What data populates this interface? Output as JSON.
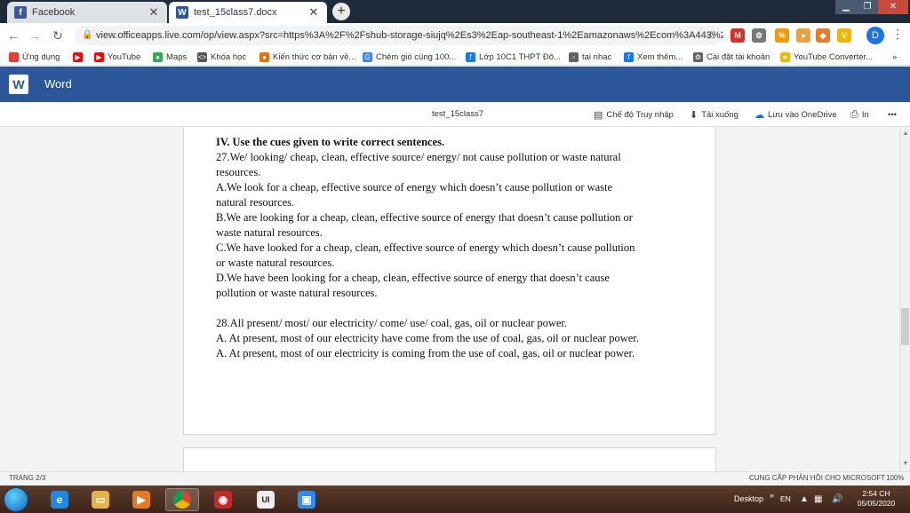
{
  "browser": {
    "tabs": [
      {
        "label": "Facebook",
        "icon": "facebook-icon",
        "color": "#3b5998"
      },
      {
        "label": "test_15class7.docx",
        "icon": "word-icon",
        "color": "#2b579a"
      }
    ],
    "url": "view.officeapps.live.com/op/view.aspx?src=https%3A%2F%2Fshub-storage-siujq%2Es3%2Eap-southeast-1%2Eamazonaws%2Ecom%3A443%2Ft...",
    "profile_initial": "D",
    "bookmarks": [
      {
        "label": "Ứng dụng",
        "icon": "apps-icon",
        "color": "#e53935"
      },
      {
        "label": "",
        "icon": "youtube-icon",
        "color": "#ff0000"
      },
      {
        "label": "YouTube",
        "icon": "youtube-icon",
        "color": "#ff0000"
      },
      {
        "label": "Maps",
        "icon": "maps-icon",
        "color": "#34a853"
      },
      {
        "label": "Khóa học",
        "icon": "code-icon",
        "color": "#555555"
      },
      {
        "label": "Kiến thức cơ bản về...",
        "icon": "github-icon",
        "color": "#e8710a"
      },
      {
        "label": "Chém gió cùng 100...",
        "icon": "google-icon",
        "color": "#4285f4"
      },
      {
        "label": "Lớp 10C1 THPT Đô...",
        "icon": "facebook-icon",
        "color": "#1877f2"
      },
      {
        "label": "tai nhac",
        "icon": "page-icon",
        "color": "#5f6368"
      },
      {
        "label": "Xem thêm...",
        "icon": "facebook-icon",
        "color": "#1877f2"
      },
      {
        "label": "Cài đặt tài khoản",
        "icon": "settings-icon",
        "color": "#5f6368"
      },
      {
        "label": "YouTube Converter...",
        "icon": "bookmark-icon",
        "color": "#f4b400"
      }
    ]
  },
  "word": {
    "app_name": "Word",
    "doc_name": "test_15class7",
    "toolbar": {
      "reading_mode": "Chế độ Truy nhập",
      "download": "Tải xuống",
      "save_onedrive": "Lưu vào OneDrive",
      "print": "In",
      "more": "•••"
    }
  },
  "document": {
    "lines": [
      {
        "text": "IV. Use the cues given to write correct sentences.",
        "bold": true
      },
      {
        "text": "27.We/ looking/ cheap, clean, effective source/ energy/ not cause pollution or waste natural"
      },
      {
        "text": "resources."
      },
      {
        "text": "A.We look for a cheap, effective source of energy which doesn’t cause pollution or waste"
      },
      {
        "text": "natural resources."
      },
      {
        "text": "B.We are looking for a cheap, clean, effective source of energy that doesn’t cause pollution or"
      },
      {
        "text": "waste natural resources."
      },
      {
        "text": "C.We have looked for a cheap, clean, effective source of energy which doesn’t cause pollution"
      },
      {
        "text": "or waste natural resources."
      },
      {
        "text": "D.We have been looking for a cheap, clean, effective source of energy that doesn’t cause"
      },
      {
        "text": "pollution or waste natural resources."
      },
      {
        "text": ""
      },
      {
        "text": "28.All present/ most/ our electricity/ come/ use/ coal, gas, oil or nuclear power."
      },
      {
        "text": "A. At present, most of our electricity have come from the use of coal, gas, oil or nuclear power."
      },
      {
        "text": "A. At present, most of our electricity is coming from the use of coal, gas, oil or nuclear power."
      }
    ]
  },
  "status": {
    "page": "TRANG 2/3",
    "feedback": "CUNG CẤP PHẢN HỒI CHO MICROSOFT",
    "zoom": "100%"
  },
  "taskbar": {
    "desktop_label": "Desktop",
    "lang": "EN",
    "time": "2:54 CH",
    "date": "05/05/2020"
  }
}
